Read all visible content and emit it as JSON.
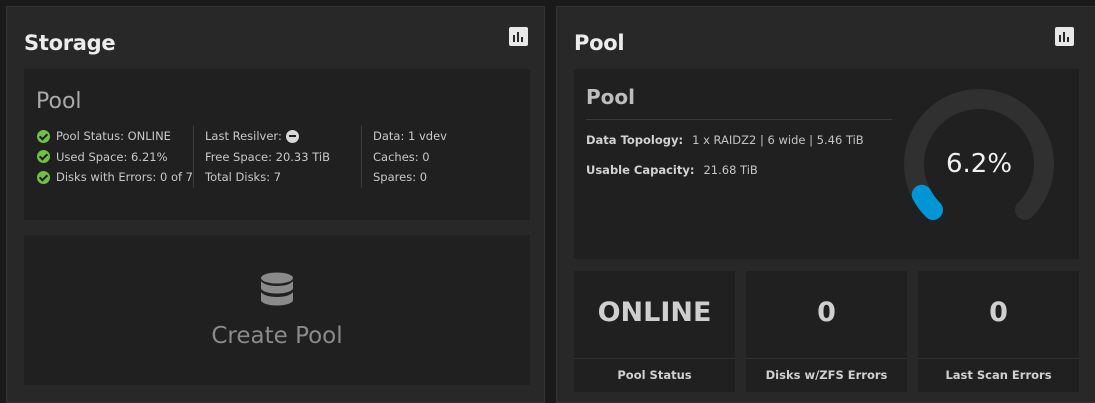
{
  "storage": {
    "title": "Storage",
    "pool_name": "Pool",
    "col1": [
      {
        "label": "Pool Status:",
        "value": "ONLINE"
      },
      {
        "label": "Used Space:",
        "value": "6.21%"
      },
      {
        "label": "Disks with Errors:",
        "value": "0 of 7"
      }
    ],
    "col2": [
      {
        "label": "Last Resilver:",
        "icon": "minus-circle-icon"
      },
      {
        "label": "Free Space:",
        "value": "20.33 TiB"
      },
      {
        "label": "Total Disks:",
        "value": "7"
      }
    ],
    "col3": [
      {
        "label": "Data:",
        "value": "1 vdev"
      },
      {
        "label": "Caches:",
        "value": "0"
      },
      {
        "label": "Spares:",
        "value": "0"
      }
    ],
    "create_pool_label": "Create Pool"
  },
  "pool": {
    "title": "Pool",
    "name": "Pool",
    "data_topology_label": "Data Topology:",
    "data_topology_value": "1 x RAIDZ2 | 6 wide | 5.46 TiB",
    "usable_capacity_label": "Usable Capacity:",
    "usable_capacity_value": "21.68 TiB",
    "gauge_text": "6.2%",
    "gauge_fraction": 0.062,
    "gauge_color": "#0095d5",
    "gauge_track_color": "#303030",
    "stats": [
      {
        "value": "ONLINE",
        "label": "Pool Status"
      },
      {
        "value": "0",
        "label": "Disks w/ZFS Errors"
      },
      {
        "value": "0",
        "label": "Last Scan Errors"
      }
    ]
  },
  "icons": {
    "status_ok": "check-circle-icon",
    "chart": "bar-chart-icon",
    "database": "database-icon"
  },
  "colors": {
    "ok_green": "#71bf44",
    "card_bg": "#282828",
    "panel_bg": "#202020"
  }
}
